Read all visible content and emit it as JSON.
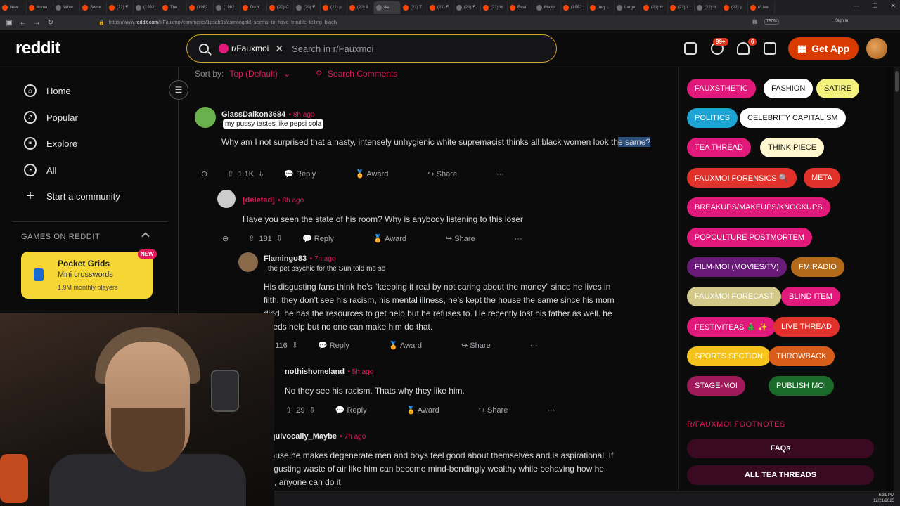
{
  "browser": {
    "tabs": [
      "New",
      "Asmo",
      "Wher",
      "Some",
      "(22) E",
      "(1982",
      "The r",
      "(1982",
      "(1982",
      "Do Y",
      "(20) C",
      "(20) E",
      "(22) p",
      "(20) 8",
      "As",
      "(21) T",
      "(21) E",
      "(21) E",
      "(21) H",
      "Real",
      "Mayb",
      "(1982",
      "they c",
      "Large",
      "(21) H",
      "(22) L",
      "(22) H",
      "(22) p",
      "r/Live"
    ],
    "active_tab_index": 14,
    "url_prefix": "https://www.",
    "url_domain": "reddit.com",
    "url_path": "/r/Fauxmoi/comments/1psab9s/asmongold_seems_to_have_trouble_telling_black/",
    "zoom": "150%",
    "signin": "Sign in"
  },
  "header": {
    "logo": "reddit",
    "search_chip": "r/Fauxmoi",
    "search_placeholder": "Search in r/Fauxmoi",
    "chat_badge": "99+",
    "notif_badge": "6",
    "get_app": "Get App"
  },
  "leftnav": {
    "items": [
      {
        "label": "Home",
        "icon": "home-icon"
      },
      {
        "label": "Popular",
        "icon": "popular-icon"
      },
      {
        "label": "Explore",
        "icon": "explore-icon"
      },
      {
        "label": "All",
        "icon": "all-icon"
      },
      {
        "label": "Start a community",
        "icon": "plus-icon"
      }
    ],
    "games_heading": "GAMES ON REDDIT",
    "game": {
      "title": "Pocket Grids",
      "subtitle": "Mini crosswords",
      "players": "1.9M monthly players",
      "badge": "NEW"
    }
  },
  "sort": {
    "label": "Sort by:",
    "value": "Top (Default)",
    "search_comments": "Search Comments"
  },
  "comments": [
    {
      "author": "GlassDaikon3684",
      "time": "8h ago",
      "flair": "my pussy tastes like pepsi cola",
      "body_start": "Why am I not surprised that a nasty, intensely unhygienic white supremacist thinks all black women look th",
      "body_highlight": "e same?",
      "votes": "1.1K"
    },
    {
      "author": "[deleted]",
      "time": "8h ago",
      "body": "Have you seen the state of his room? Why is anybody listening to this loser",
      "votes": "181"
    },
    {
      "author": "Flamingo83",
      "time": "7h ago",
      "flair": "the pet psychic for the Sun told me so",
      "body_lines": [
        "His disgusting fans think he’s “keeping it real by not caring about the money” since he lives in",
        "filth. they don’t see his racism, his mental illness, he’s kept the house the same since his mom",
        "died. he has the resources to get help but he refuses to. He recently lost his father as well. he",
        "needs help but no one can make him do that."
      ],
      "votes": "116"
    },
    {
      "author": "nothishomeland",
      "time": "5h ago",
      "body": "No they see his racism. Thats why they like him.",
      "votes": "29"
    },
    {
      "author": "Unequivocally_Maybe",
      "time": "7h ago",
      "body_lines": [
        "Because he makes degenerate men and boys feel good about themselves and is aspirational. If",
        "a disgusting waste of air like him can become mind-bendingly wealthy while behaving how he",
        "does, anyone can do it."
      ]
    }
  ],
  "actions": {
    "reply": "Reply",
    "award": "Award",
    "share": "Share",
    "more": "···"
  },
  "flairs": [
    {
      "label": "FAUXSTHETIC",
      "bg": "#e0197a",
      "fg": "#ffffff"
    },
    {
      "label": "FASHION",
      "bg": "#ffffff",
      "fg": "#111111"
    },
    {
      "label": "SATIRE",
      "bg": "#f4f27c",
      "fg": "#111111"
    },
    {
      "label": "POLITICS",
      "bg": "#1ea3d4",
      "fg": "#ffffff"
    },
    {
      "label": "CELEBRITY CAPITALISM",
      "bg": "#ffffff",
      "fg": "#111111"
    },
    {
      "label": "TEA THREAD",
      "bg": "#e0197a",
      "fg": "#ffffff"
    },
    {
      "label": "THINK PIECE",
      "bg": "#fff7cf",
      "fg": "#111111"
    },
    {
      "label": "FAUXMOI FORENSICS 🔍",
      "bg": "#e0322a",
      "fg": "#ffffff"
    },
    {
      "label": "META",
      "bg": "#e0322a",
      "fg": "#ffffff"
    },
    {
      "label": "BREAKUPS/MAKEUPS/KNOCKUPS",
      "bg": "#e0197a",
      "fg": "#ffffff"
    },
    {
      "label": "POPCULTURE POSTMORTEM",
      "bg": "#e0197a",
      "fg": "#ffffff"
    },
    {
      "label": "FILM-MOI (MOVIES/TV)",
      "bg": "#6a1b7a",
      "fg": "#ffffff"
    },
    {
      "label": "FM RADIO",
      "bg": "#b36a1b",
      "fg": "#ffffff"
    },
    {
      "label": "FAUXMOI FORECAST",
      "bg": "#d2c98a",
      "fg": "#ffffff"
    },
    {
      "label": "BLIND ITEM",
      "bg": "#e0197a",
      "fg": "#ffffff"
    },
    {
      "label": "FESTIVITEAS 🎄 ✨",
      "bg": "#e0197a",
      "fg": "#ffffff"
    },
    {
      "label": "LIVE THREAD",
      "bg": "#e0322a",
      "fg": "#ffffff"
    },
    {
      "label": "SPORTS SECTION",
      "bg": "#f4c21a",
      "fg": "#ffffff"
    },
    {
      "label": "THROWBACK",
      "bg": "#d95d1a",
      "fg": "#ffffff"
    },
    {
      "label": "STAGE-MOI",
      "bg": "#a01a5a",
      "fg": "#ffffff"
    },
    {
      "label": "PUBLISH MOI",
      "bg": "#1a6a2a",
      "fg": "#ffffff"
    }
  ],
  "footnotes": {
    "heading": "R/FAUXMOI FOOTNOTES",
    "faqs": "FAQs",
    "tea_threads": "ALL TEA THREADS"
  },
  "clock": {
    "time": "6:31 PM",
    "date": "12/21/2025"
  }
}
